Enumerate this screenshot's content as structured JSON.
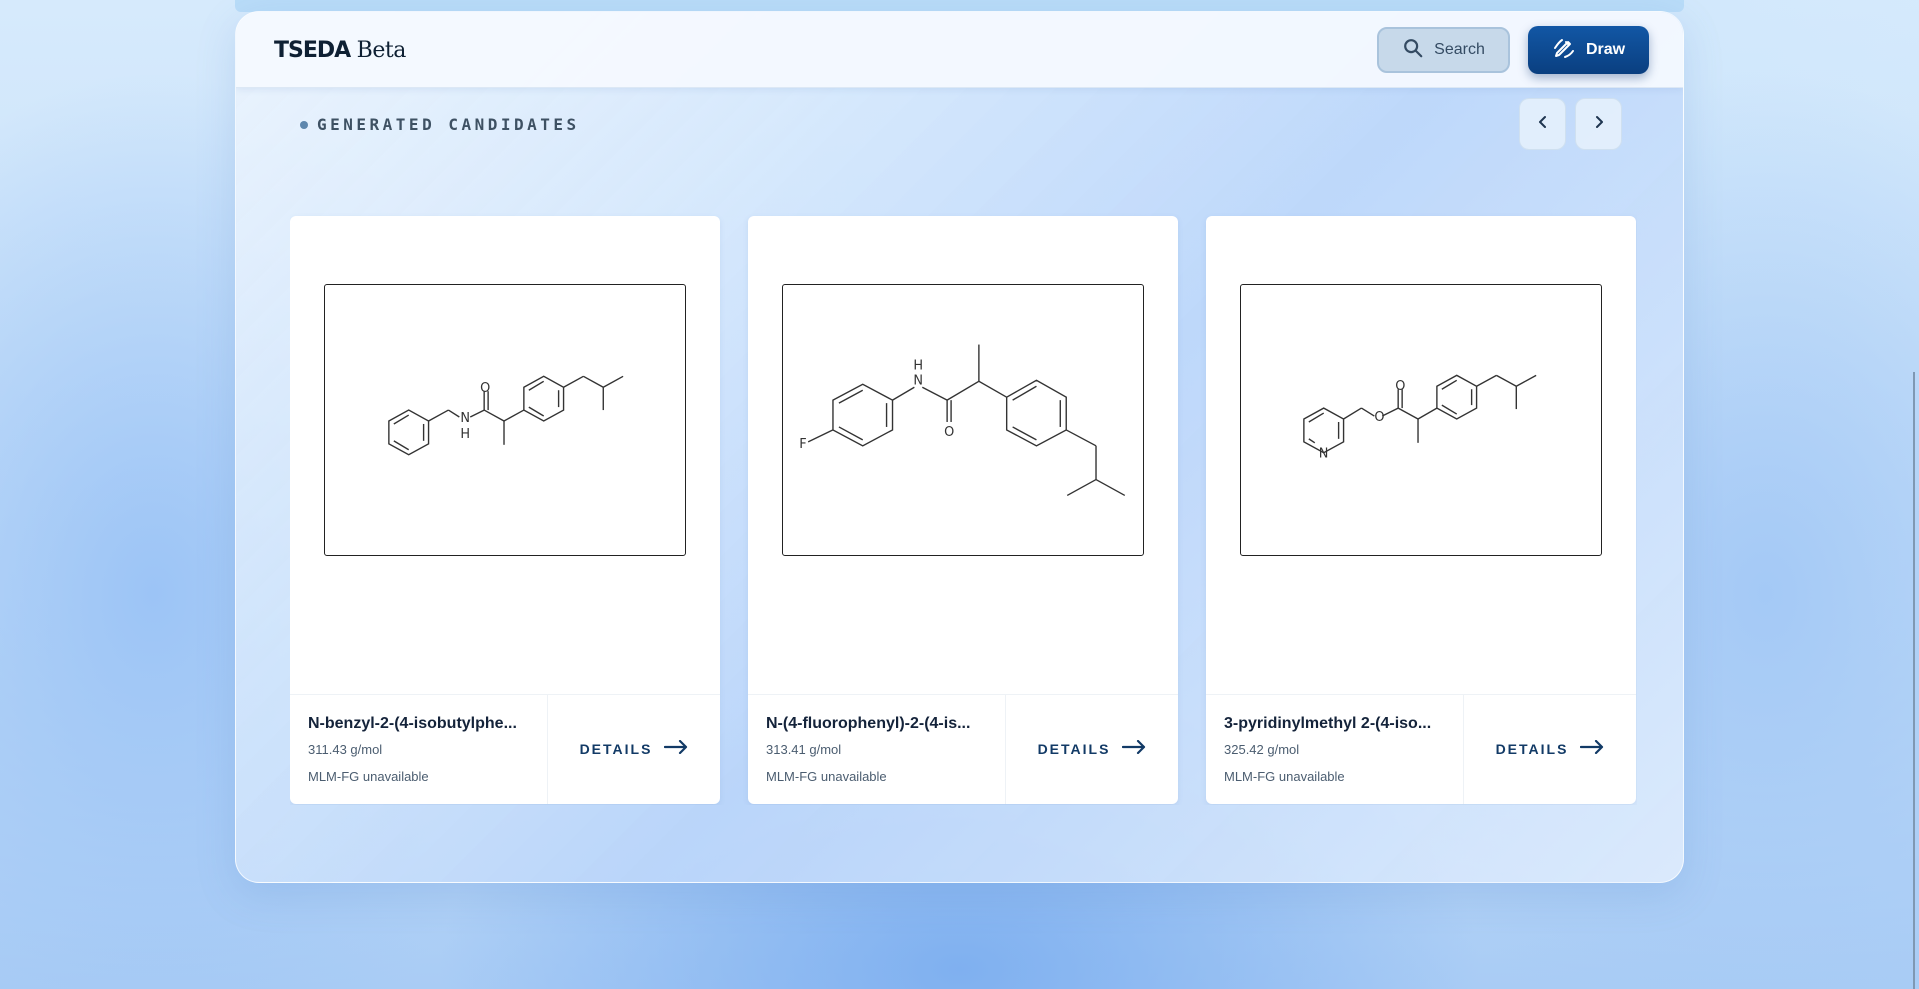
{
  "app": {
    "brand_strong": "TSEDA",
    "brand_light": " Beta"
  },
  "header": {
    "search_label": "Search",
    "draw_label": "Draw"
  },
  "section": {
    "title": "GENERATED CANDIDATES"
  },
  "cards": [
    {
      "name": "N-benzyl-2-(4-isobutylphe...",
      "mw": "311.43 g/mol",
      "mlm": "MLM-FG unavailable",
      "details": "DETAILS"
    },
    {
      "name": "N-(4-fluorophenyl)-2-(4-is...",
      "mw": "313.41 g/mol",
      "mlm": "MLM-FG unavailable",
      "details": "DETAILS"
    },
    {
      "name": "3-pyridinylmethyl 2-(4-iso...",
      "mw": "325.42 g/mol",
      "mlm": "MLM-FG unavailable",
      "details": "DETAILS"
    }
  ],
  "molecules": [
    {
      "atoms": [
        "O",
        "N",
        "H"
      ]
    },
    {
      "atoms": [
        "H",
        "N",
        "O",
        "F"
      ]
    },
    {
      "atoms": [
        "O",
        "O",
        "N"
      ]
    }
  ],
  "colors": {
    "accent": "#0a3f80",
    "text": "#14233a",
    "muted": "#4b5d70"
  },
  "icons": {
    "search": "search-icon",
    "draw": "pencil-draw-icon",
    "prev": "chevron-left-icon",
    "next": "chevron-right-icon",
    "details": "arrow-right-icon"
  }
}
